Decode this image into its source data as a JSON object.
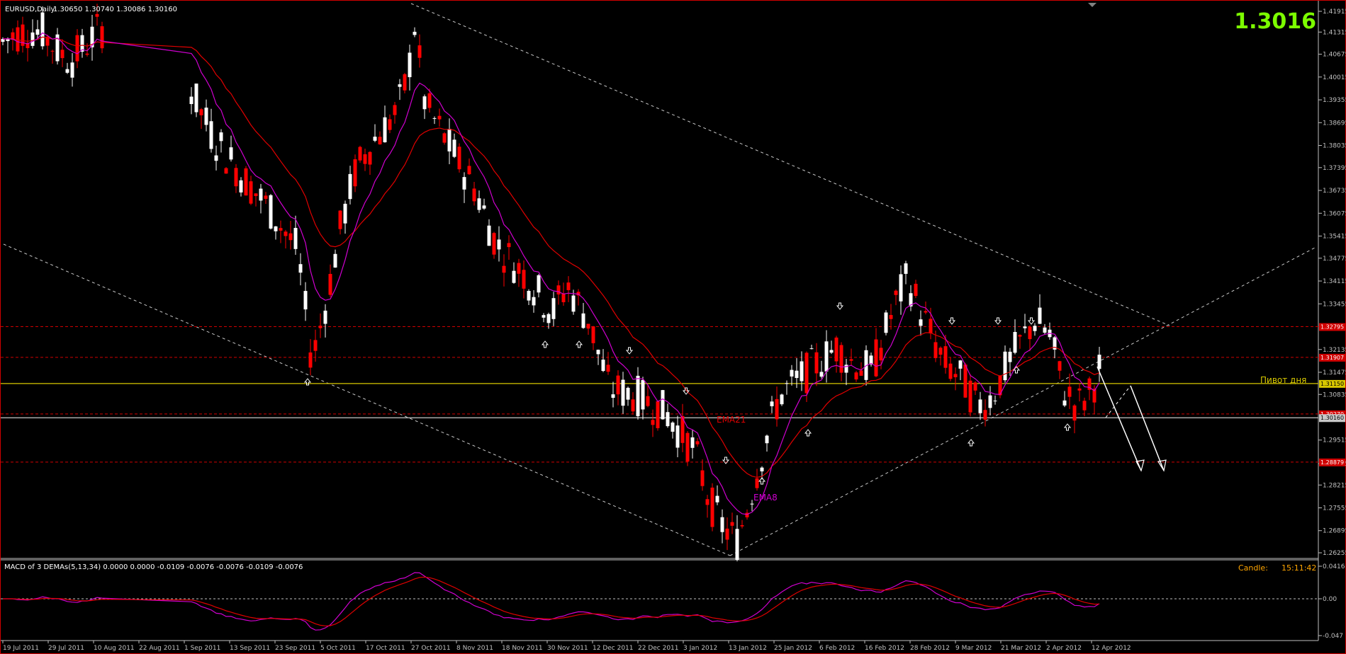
{
  "header": {
    "symbol_label": "EURUSD,Daily",
    "ohlc_label": "1.30650 1.30740 1.30086 1.30160"
  },
  "big_price": "1.3016",
  "main_yaxis_ticks": [
    "1.41915",
    "1.41315",
    "1.40675",
    "1.40015",
    "1.39355",
    "1.38695",
    "1.38035",
    "1.37395",
    "1.36735",
    "1.36075",
    "1.35415",
    "1.34775",
    "1.34115",
    "1.33455",
    "1.32135",
    "1.31475",
    "1.30835",
    "1.29515",
    "1.28835",
    "1.28215",
    "1.27555",
    "1.26895",
    "1.26255"
  ],
  "levels": [
    {
      "label": "1.32795",
      "color": "#d00000"
    },
    {
      "label": "1.31907",
      "color": "#d00000"
    },
    {
      "label": "1.31150",
      "color": "#d8c800"
    },
    {
      "label": "1.30270",
      "color": "#d00000"
    },
    {
      "label": "1.30160",
      "color": "#c8c8c8"
    },
    {
      "label": "1.28879",
      "color": "#d00000"
    }
  ],
  "annotations": {
    "pivot": "Пивот дня",
    "ema21": "EMA21",
    "ema8": "EMA8"
  },
  "macd": {
    "title": "MACD of 3 DEMAs(5,13,34) 0.0000 0.0000 -0.0109 -0.0076 -0.0076 -0.0109 -0.0076",
    "ticks": [
      "0.0416",
      "0.00",
      "-0.047"
    ],
    "candle_label": "Candle:",
    "candle_time": "15:11:42"
  },
  "x_axis_labels": [
    "19 Jul 2011",
    "29 Jul 2011",
    "10 Aug 2011",
    "22 Aug 2011",
    "1 Sep 2011",
    "13 Sep 2011",
    "23 Sep 2011",
    "5 Oct 2011",
    "17 Oct 2011",
    "27 Oct 2011",
    "8 Nov 2011",
    "18 Nov 2011",
    "30 Nov 2011",
    "12 Dec 2011",
    "22 Dec 2011",
    "3 Jan 2012",
    "13 Jan 2012",
    "25 Jan 2012",
    "6 Feb 2012",
    "16 Feb 2012",
    "28 Feb 2012",
    "9 Mar 2012",
    "21 Mar 2012",
    "2 Apr 2012",
    "12 Apr 2012"
  ],
  "colors": {
    "bull": "#ffffff",
    "bear": "#ff0000",
    "ema21": "#e00000",
    "ema8": "#d000d0",
    "grid": "#c0c0c0",
    "pivot": "#d8c800",
    "big_price": "#7cfc00"
  },
  "chart_data": {
    "type": "candlestick",
    "title": "EURUSD,Daily",
    "ylim": [
      1.26255,
      1.41915
    ],
    "series": [
      {
        "name": "EMA21"
      },
      {
        "name": "EMA8"
      }
    ]
  }
}
